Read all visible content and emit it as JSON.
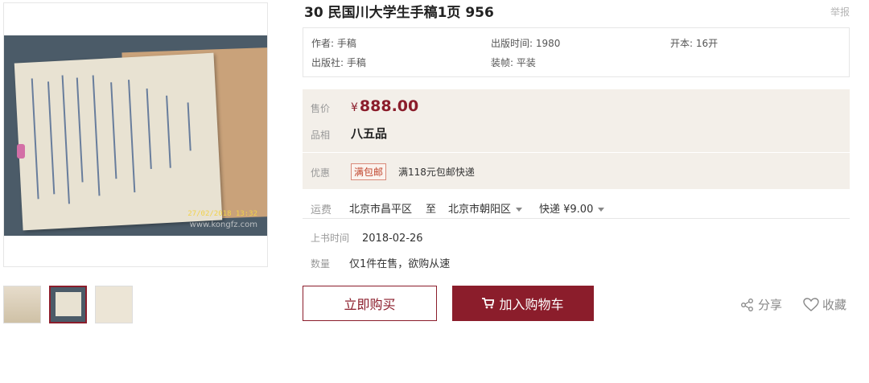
{
  "product": {
    "title": "30 民国川大学生手稿1页 956",
    "report_label": "举报"
  },
  "image": {
    "stamp_text": "27/02/2018 13:32",
    "watermark": "www.kongfz.com",
    "thumb_count": 3,
    "active_thumb": 2
  },
  "attributes": {
    "author": "作者: 手稿",
    "publish_time": "出版时间: 1980",
    "format": "开本: 16开",
    "publisher": "出版社: 手稿",
    "binding": "装帧: 平装"
  },
  "pricing": {
    "price_label": "售价",
    "currency": "¥",
    "price": "888.00",
    "condition_label": "品相",
    "condition": "八五品",
    "promo_label": "优惠",
    "promo_tag": "满包邮",
    "promo_text": "满118元包邮快递"
  },
  "shipping": {
    "label": "运费",
    "from": "北京市昌平区",
    "to_word": "至",
    "to": "北京市朝阳区",
    "method": "快递 ¥9.00"
  },
  "listing": {
    "date_label": "上书时间",
    "date": "2018-02-26",
    "qty_label": "数量",
    "qty": "仅1件在售，欲购从速"
  },
  "actions": {
    "buy_now": "立即购买",
    "add_to_cart": "加入购物车",
    "share": "分享",
    "favorite": "收藏"
  },
  "colors": {
    "brand": "#8b1d2b",
    "price_bg": "#f3efe9"
  }
}
